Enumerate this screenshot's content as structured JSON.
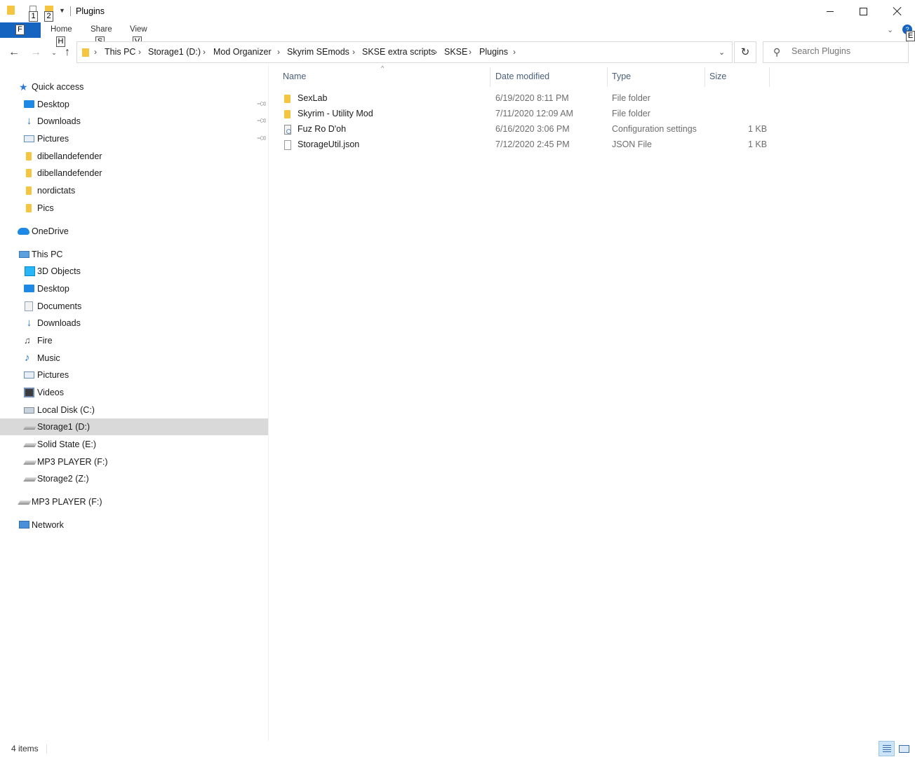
{
  "window": {
    "title": "Plugins",
    "keytips": {
      "qat_1": "1",
      "qat_2": "2",
      "file": "F",
      "home": "H",
      "share": "S",
      "view": "V",
      "help": "E"
    }
  },
  "ribbon": {
    "tabs": [
      "Home",
      "Share",
      "View"
    ],
    "help_label": "?"
  },
  "address": {
    "breadcrumbs": [
      "This PC",
      "Storage1 (D:)",
      "Mod Organizer",
      "Skyrim SEmods",
      "SKSE extra scripts",
      "SKSE",
      "Plugins"
    ]
  },
  "search": {
    "placeholder": "Search Plugins"
  },
  "nav": {
    "quick_access": {
      "label": "Quick access",
      "items": [
        {
          "label": "Desktop",
          "icon": "desktop-icon",
          "pinned": true
        },
        {
          "label": "Downloads",
          "icon": "downloads-icon",
          "pinned": true
        },
        {
          "label": "Pictures",
          "icon": "pictures-icon",
          "pinned": true
        },
        {
          "label": "dibellandefender",
          "icon": "folder-icon",
          "pinned": false
        },
        {
          "label": "dibellandefender",
          "icon": "folder-icon",
          "pinned": false
        },
        {
          "label": "nordictats",
          "icon": "folder-icon",
          "pinned": false
        },
        {
          "label": "Pics",
          "icon": "folder-icon",
          "pinned": false
        }
      ]
    },
    "onedrive": {
      "label": "OneDrive"
    },
    "this_pc": {
      "label": "This PC",
      "items": [
        {
          "label": "3D Objects",
          "icon": "3d-objects-icon"
        },
        {
          "label": "Desktop",
          "icon": "desktop-icon"
        },
        {
          "label": "Documents",
          "icon": "documents-icon"
        },
        {
          "label": "Downloads",
          "icon": "downloads-icon"
        },
        {
          "label": "Fire",
          "icon": "fire-icon"
        },
        {
          "label": "Music",
          "icon": "music-icon"
        },
        {
          "label": "Pictures",
          "icon": "pictures-icon"
        },
        {
          "label": "Videos",
          "icon": "videos-icon"
        },
        {
          "label": "Local Disk (C:)",
          "icon": "local-disk-icon"
        },
        {
          "label": "Storage1 (D:)",
          "icon": "drive-icon",
          "selected": true
        },
        {
          "label": "Solid State (E:)",
          "icon": "drive-icon"
        },
        {
          "label": "MP3 PLAYER (F:)",
          "icon": "drive-icon"
        },
        {
          "label": "Storage2 (Z:)",
          "icon": "drive-icon"
        }
      ]
    },
    "mp3_player": {
      "label": "MP3 PLAYER (F:)"
    },
    "network": {
      "label": "Network"
    }
  },
  "files": {
    "columns": {
      "name": "Name",
      "date": "Date modified",
      "type": "Type",
      "size": "Size"
    },
    "rows": [
      {
        "name": "SexLab",
        "date": "6/19/2020 8:11 PM",
        "type": "File folder",
        "size": "",
        "icon": "folder-icon"
      },
      {
        "name": "Skyrim - Utility Mod",
        "date": "7/11/2020 12:09 AM",
        "type": "File folder",
        "size": "",
        "icon": "folder-icon"
      },
      {
        "name": "Fuz Ro D'oh",
        "date": "6/16/2020 3:06 PM",
        "type": "Configuration settings",
        "size": "1 KB",
        "icon": "config-file-icon"
      },
      {
        "name": "StorageUtil.json",
        "date": "7/12/2020 2:45 PM",
        "type": "JSON File",
        "size": "1 KB",
        "icon": "json-file-icon"
      }
    ]
  },
  "status": {
    "item_count": "4 items"
  },
  "colors": {
    "accent": "#1565c0",
    "selected_row": "#d9d9d9",
    "header_text": "#4c607a",
    "folder": "#f5c542"
  }
}
